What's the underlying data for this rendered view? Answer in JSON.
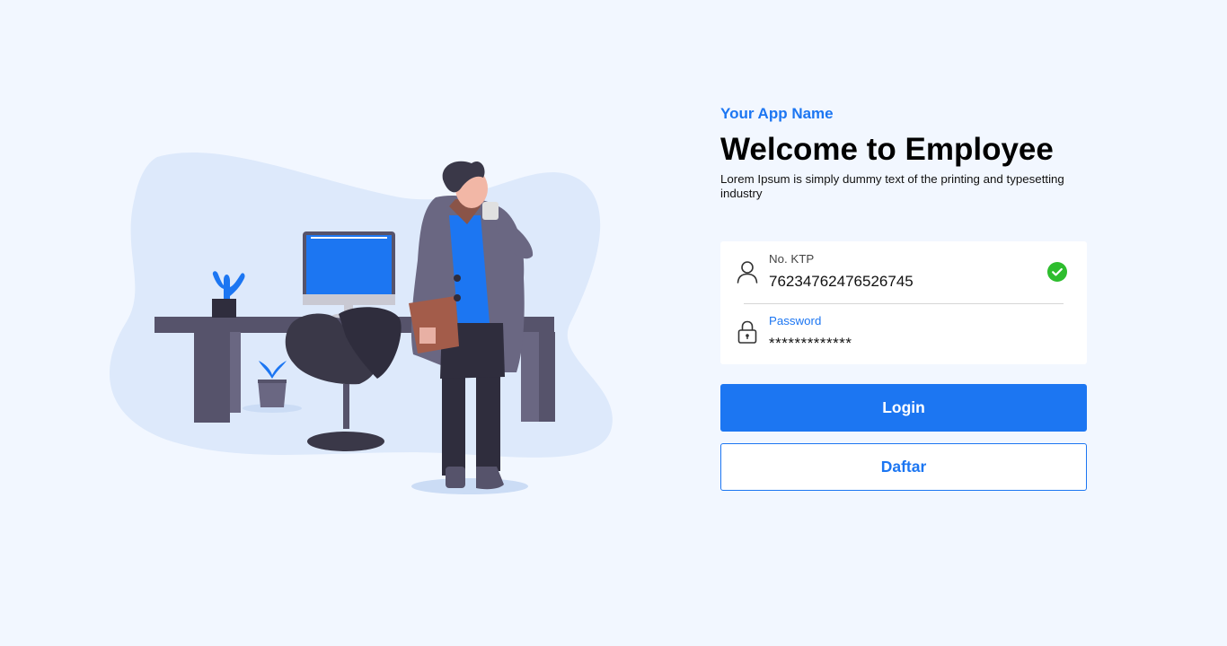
{
  "header": {
    "app_name": "Your App Name",
    "title": "Welcome to Employee",
    "subtitle": "Lorem Ipsum is simply dummy text of the printing and typesetting industry"
  },
  "form": {
    "ktp": {
      "label": "No. KTP",
      "value": "76234762476526745",
      "icon": "user-icon",
      "status_icon": "check-circle-icon"
    },
    "password": {
      "label": "Password",
      "value": "*************",
      "icon": "lock-icon"
    }
  },
  "actions": {
    "login_label": "Login",
    "register_label": "Daftar"
  },
  "colors": {
    "accent": "#1c76f2",
    "background": "#f2f7ff",
    "success": "#2ebd2e",
    "illustration_blob": "#dde9fb"
  }
}
